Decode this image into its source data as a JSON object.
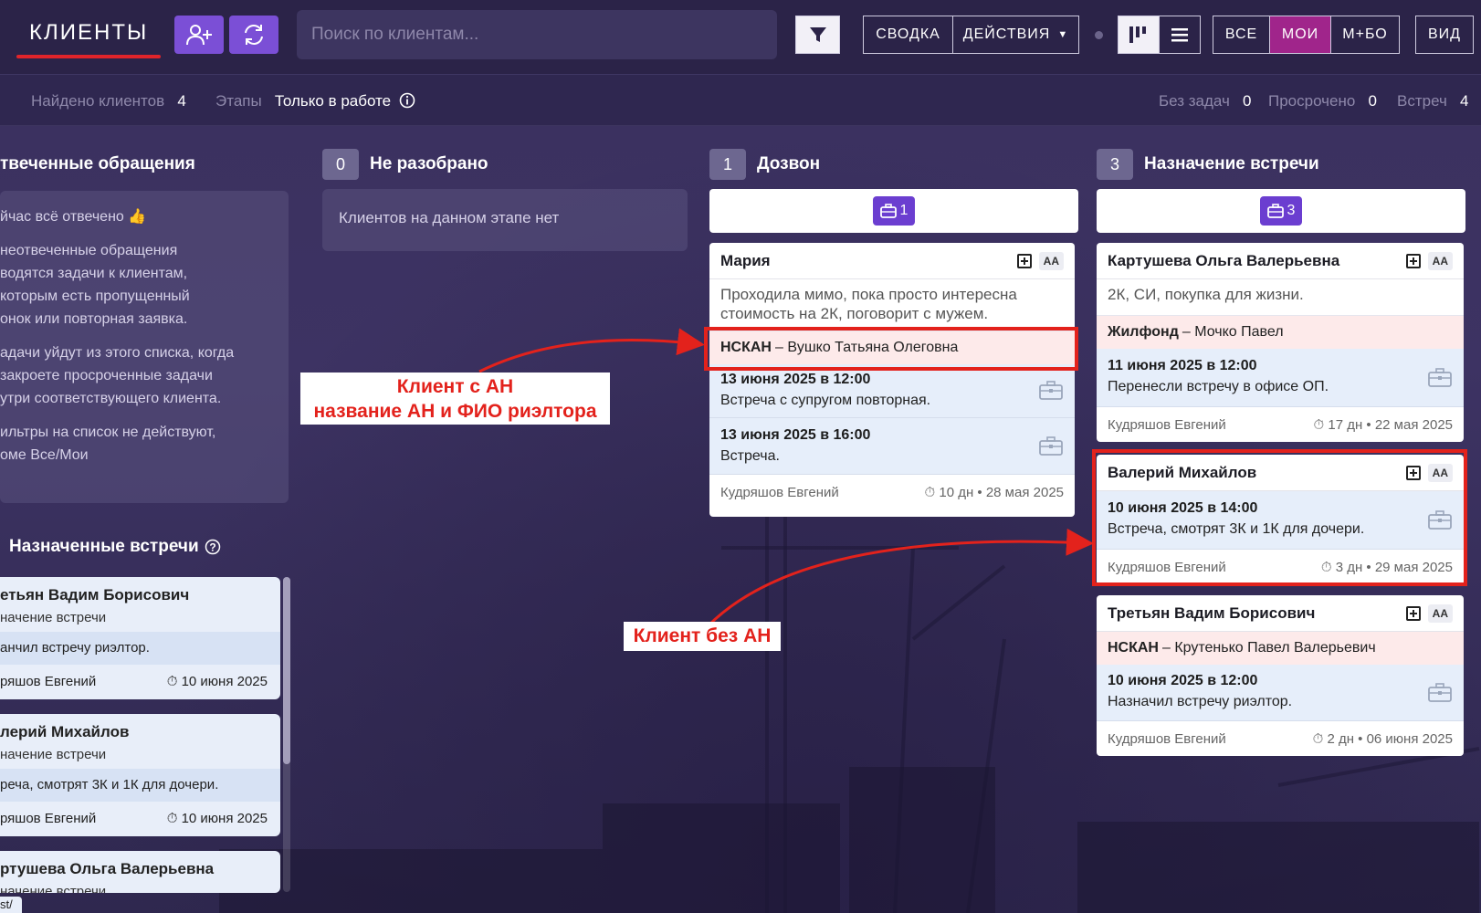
{
  "header": {
    "brand": "КЛИЕНТЫ",
    "search_placeholder": "Поиск по клиентам...",
    "summary": "СВОДКА",
    "actions": "ДЕЙСТВИЯ",
    "filter_all": "ВСЕ",
    "filter_mine": "МОИ",
    "filter_mbo": "М+БО",
    "view": "ВИД"
  },
  "subbar": {
    "found_label": "Найдено клиентов",
    "found_value": "4",
    "stages_label": "Этапы",
    "stages_value": "Только в работе",
    "no_tasks_label": "Без задач",
    "no_tasks_value": "0",
    "overdue_label": "Просрочено",
    "overdue_value": "0",
    "meetings_label": "Встреч",
    "meetings_value": "4"
  },
  "left": {
    "title": "твеченные обращения",
    "p1": "йчас всё отвечено 👍",
    "p2a": "неотвеченные обращения",
    "p2b": "водятся задачи к клиентам,",
    "p2c": "которым есть пропущенный",
    "p2d": "онок или повторная заявка.",
    "p3a": "адачи уйдут из этого списка, когда",
    "p3b": "закроете просроченные задачи",
    "p3c": "утри соответствующего клиента.",
    "p4a": "ильтры на список не действуют,",
    "p4b": "оме Все/Мои",
    "meetings_title": "Назначенные встречи",
    "meetings": [
      {
        "name": "етьян Вадим Борисович",
        "stage": "начение встречи",
        "note": "анчил встречу риэлтор.",
        "agent": "ряшов Евгений",
        "date": "10 июня 2025"
      },
      {
        "name": "лерий Михайлов",
        "stage": "начение встречи",
        "note": "реча, смотрят 3К и 1К для дочери.",
        "agent": "ряшов Евгений",
        "date": "10 июня 2025"
      },
      {
        "name": "ртушева Ольга Валерьевна",
        "stage": "начение встречи"
      }
    ],
    "bottom_tag": "st/"
  },
  "columns": {
    "unsorted": {
      "count": "0",
      "title": "Не разобрано",
      "empty": "Клиентов на данном этапе нет"
    },
    "calling": {
      "count": "1",
      "title": "Дозвон",
      "badge": "1"
    },
    "meeting": {
      "count": "3",
      "title": "Назначение встречи",
      "badge": "3"
    }
  },
  "cards": {
    "maria": {
      "name": "Мария",
      "aa": "AA",
      "desc": "Проходила мимо, пока просто интересна стоимость на 2К, поговорит с мужем.",
      "agency": "НСКАН",
      "realtor": "– Вушко Татьяна Олеговна",
      "t1_date": "13 июня 2025 в 12:00",
      "t1_text": "Встреча с супругом повторная.",
      "t2_date": "13 июня 2025 в 16:00",
      "t2_text": "Встреча.",
      "agent": "Кудряшов Евгений",
      "age": "10 дн • 28 мая 2025"
    },
    "kartusheva": {
      "name": "Картушева Ольга Валерьевна",
      "aa": "AA",
      "desc": "2К, СИ, покупка для жизни.",
      "agency": "Жилфонд",
      "realtor": "– Мочко Павел",
      "t1_date": "11 июня 2025 в 12:00",
      "t1_text": "Перенесли встречу в офисе ОП.",
      "agent": "Кудряшов Евгений",
      "age": "17 дн • 22 мая 2025"
    },
    "valery": {
      "name": "Валерий Михайлов",
      "aa": "AA",
      "t1_date": "10 июня 2025 в 14:00",
      "t1_text": "Встреча, смотрят 3К и 1К для дочери.",
      "agent": "Кудряшов Евгений",
      "age": "3 дн • 29 мая 2025"
    },
    "tretyan": {
      "name": "Третьян Вадим Борисович",
      "aa": "AA",
      "agency": "НСКАН",
      "realtor": "– Крутенько Павел Валерьевич",
      "t1_date": "10 июня 2025 в 12:00",
      "t1_text": "Назначил встречу риэлтор.",
      "agent": "Кудряшов Евгений",
      "age": "2 дн • 06 июня 2025"
    }
  },
  "annotations": {
    "with_agency_1": "Клиент с АН",
    "with_agency_2": "название АН и ФИО риэлтора",
    "without_agency": "Клиент без АН"
  },
  "colors": {
    "accent_red": "#e3221c",
    "brand_purple": "#7b4fd6",
    "mine_magenta": "#a0258b"
  }
}
